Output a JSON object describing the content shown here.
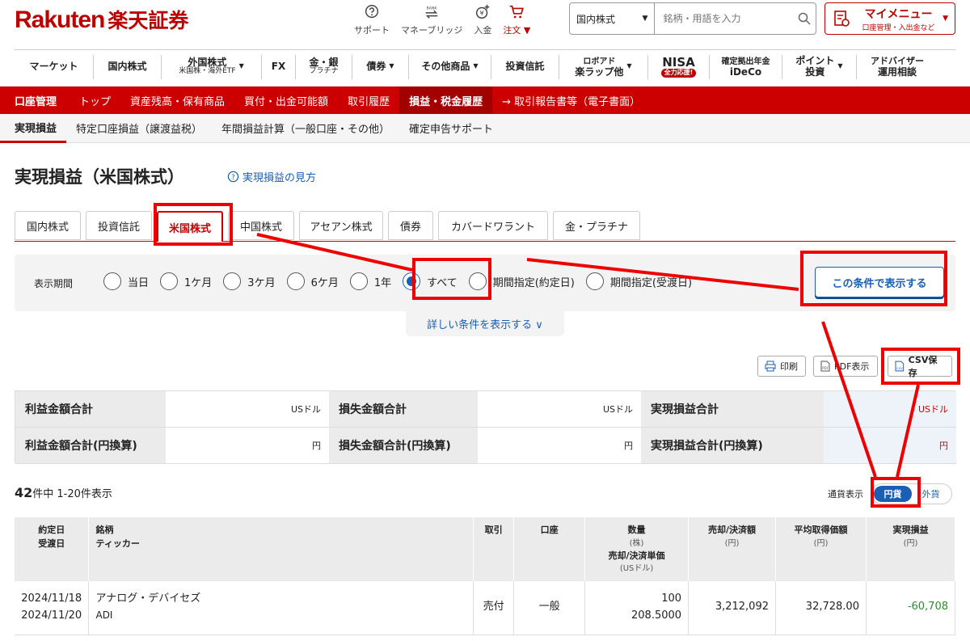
{
  "header": {
    "logo_rakuten": "Rakuten",
    "logo_jp": "楽天証券",
    "icons": [
      {
        "label": "サポート",
        "icon": "support-icon"
      },
      {
        "label": "マネーブリッジ",
        "icon": "bank-icon"
      },
      {
        "label": "入金",
        "icon": "deposit-icon"
      },
      {
        "label": "注文 ▼",
        "icon": "cart-icon"
      }
    ],
    "search_select": "国内株式",
    "search_placeholder": "銘柄・用語を入力",
    "mymenu_title": "マイメニュー",
    "mymenu_sub": "口座管理・入出金など"
  },
  "mainnav": [
    {
      "label": "マーケット"
    },
    {
      "label": "国内株式"
    },
    {
      "label": "外国株式",
      "sub": "米国株・海外ETF",
      "arrow": "▼"
    },
    {
      "label": "FX"
    },
    {
      "label": "金・銀",
      "sub": "プラチナ"
    },
    {
      "label": "債券",
      "arrow": "▼"
    },
    {
      "label": "その他商品",
      "arrow": "▼"
    },
    {
      "label": "投資信託"
    },
    {
      "label": "ロボアド",
      "sub": "楽ラップ他",
      "arrow": "▼"
    },
    {
      "label": "NISA",
      "badge": "全力応援!"
    },
    {
      "label": "確定拠出年金",
      "sub": "iDeCo"
    },
    {
      "label": "ポイント",
      "sub": "投資",
      "arrow": "▼"
    },
    {
      "label": "アドバイザー",
      "sub": "運用相談"
    }
  ],
  "redbar": [
    "口座管理",
    "トップ",
    "資産残高・保有商品",
    "買付・出金可能額",
    "取引履歴",
    "損益・税金履歴",
    "→ 取引報告書等（電子書面）"
  ],
  "subnav": [
    "実現損益",
    "特定口座損益（譲渡益税）",
    "年間損益計算（一般口座・その他）",
    "確定申告サポート"
  ],
  "page_title": "実現損益（米国株式）",
  "help_link": "実現損益の見方",
  "tabs": [
    "国内株式",
    "投資信託",
    "米国株式",
    "中国株式",
    "アセアン株式",
    "債券",
    "カバードワラント",
    "金・プラチナ"
  ],
  "filter": {
    "label": "表示期間",
    "options": [
      "当日",
      "1ケ月",
      "3ケ月",
      "6ケ月",
      "1年",
      "すべて",
      "期間指定(約定日)",
      "期間指定(受渡日)"
    ],
    "selected": "すべて",
    "show_button": "この条件で表示する",
    "detail_link": "詳しい条件を表示する ∨"
  },
  "actions": {
    "print": "印刷",
    "pdf": "PDF表示",
    "csv": "CSV保存"
  },
  "summary": {
    "profit_total": "利益金額合計",
    "profit_total_yen": "利益金額合計(円換算)",
    "loss_total": "損失金額合計",
    "loss_total_yen": "損失金額合計(円換算)",
    "realized_total": "実現損益合計",
    "realized_total_yen": "実現損益合計(円換算)",
    "unit_usd": "USドル",
    "unit_yen": "円"
  },
  "count": {
    "total": "42",
    "text": "件中  1-20件表示"
  },
  "currency": {
    "label": "通貨表示",
    "yen": "円貨",
    "foreign": "外貨"
  },
  "table": {
    "headers": {
      "date": "約定日",
      "date2": "受渡日",
      "name": "銘柄",
      "name2": "ティッカー",
      "trade": "取引",
      "account": "口座",
      "qty": "数量",
      "qty_u": "(株)",
      "qty2": "売却/決済単価",
      "qty2_u": "(USドル)",
      "amount": "売却/決済額",
      "amount_u": "(円)",
      "avg": "平均取得価額",
      "avg_u": "(円)",
      "pl": "実現損益",
      "pl_u": "(円)"
    },
    "rows": [
      {
        "date": "2024/11/18",
        "date2": "2024/11/20",
        "name": "アナログ・デバイセズ",
        "ticker": "ADI",
        "trade": "売付",
        "account": "一般",
        "qty": "100",
        "price": "208.5000",
        "amount": "3,212,092",
        "avg": "32,728.00",
        "pl": "-60,708"
      }
    ]
  }
}
